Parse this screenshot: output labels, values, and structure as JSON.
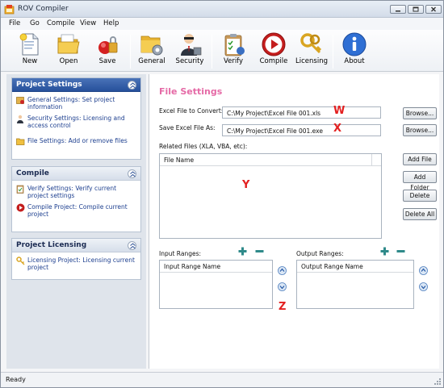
{
  "window": {
    "title": "ROV Compiler"
  },
  "menu": [
    "File",
    "Go",
    "Compile",
    "View",
    "Help"
  ],
  "toolbar": {
    "buttons": [
      {
        "label": "New",
        "icon": "new-document-icon"
      },
      {
        "label": "Open",
        "icon": "folder-open-icon"
      },
      {
        "label": "Save",
        "icon": "save-lock-icon"
      },
      {
        "label": "General",
        "icon": "folder-gear-icon"
      },
      {
        "label": "Security",
        "icon": "security-agent-icon"
      },
      {
        "label": "Verify",
        "icon": "verify-clipboard-icon"
      },
      {
        "label": "Compile",
        "icon": "compile-play-icon"
      },
      {
        "label": "Licensing",
        "icon": "keys-icon"
      },
      {
        "label": "About",
        "icon": "info-icon"
      }
    ]
  },
  "sidebar": {
    "project_settings": {
      "title": "Project Settings",
      "items": [
        {
          "text": "General Settings: Set project information",
          "icon": "settings-icon"
        },
        {
          "text": "Security Settings: Licensing and access control",
          "icon": "security-icon"
        },
        {
          "text": "File Settings: Add or remove files",
          "icon": "folder-icon"
        }
      ]
    },
    "compile": {
      "title": "Compile",
      "items": [
        {
          "text": "Verify Settings: Verify current project settings",
          "icon": "verify-icon"
        },
        {
          "text": "Compile Project: Compile current project",
          "icon": "compile-icon"
        }
      ]
    },
    "licensing": {
      "title": "Project Licensing",
      "items": [
        {
          "text": "Licensing Project: Licensing current project",
          "icon": "key-icon"
        }
      ]
    }
  },
  "main": {
    "title": "File Settings",
    "excel_label": "Excel File to Convert:",
    "excel_value": "C:\\My Project\\Excel File 001.xls",
    "save_label": "Save Excel File As:",
    "save_value": "C:\\My Project\\Excel File 001.exe",
    "browse_label": "Browse...",
    "related_label": "Related Files (XLA, VBA, etc):",
    "related_column": "File Name",
    "add_file": "Add File",
    "add_folder": "Add Folder",
    "delete": "Delete",
    "delete_all": "Delete All",
    "input_ranges_label": "Input Ranges:",
    "input_column": "Input Range Name",
    "output_ranges_label": "Output Ranges:",
    "output_column": "Output Range Name",
    "markers": {
      "w": "W",
      "x": "X",
      "y": "Y",
      "z": "Z"
    }
  },
  "status": {
    "text": "Ready"
  },
  "colors": {
    "section_title": "#e56aa6",
    "marker": "#e32020",
    "panel_header_active": "#26509b",
    "link": "#1d3f8f"
  }
}
